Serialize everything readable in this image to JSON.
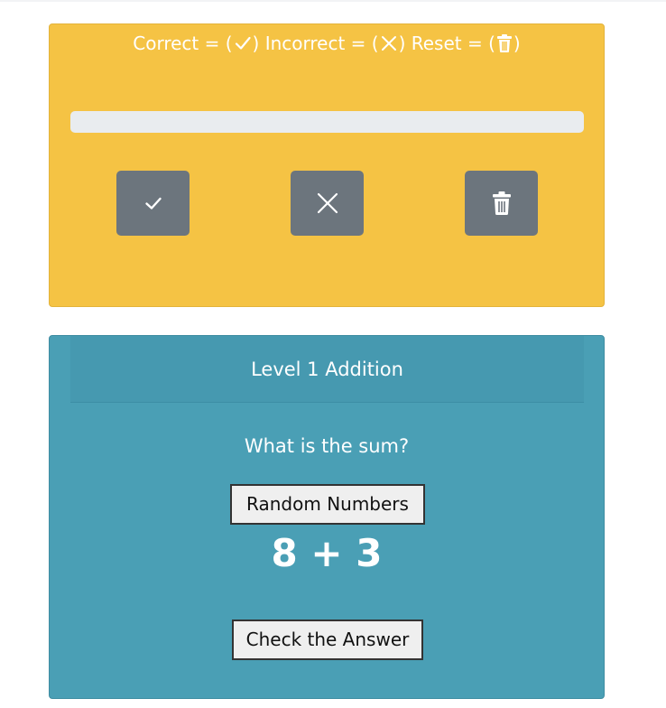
{
  "legend": {
    "correct_label": "Correct = (",
    "incorrect_label": ") Incorrect = (",
    "reset_label": ") Reset = (",
    "close_paren": ")"
  },
  "progress": {
    "value_percent": 0
  },
  "buttons": {
    "correct_icon": "check-icon",
    "incorrect_icon": "x-icon",
    "reset_icon": "trash-icon"
  },
  "quiz": {
    "header": "Level 1 Addition",
    "question": "What is the sum?",
    "random_button": "Random Numbers",
    "equation": {
      "a": "8",
      "op": " + ",
      "b": "3"
    },
    "check_button": "Check the Answer"
  },
  "colors": {
    "yellow_card": "#f5c344",
    "teal_card": "#4a9fb5",
    "icon_button": "#6c757d",
    "progress_track": "#e9ecef"
  }
}
